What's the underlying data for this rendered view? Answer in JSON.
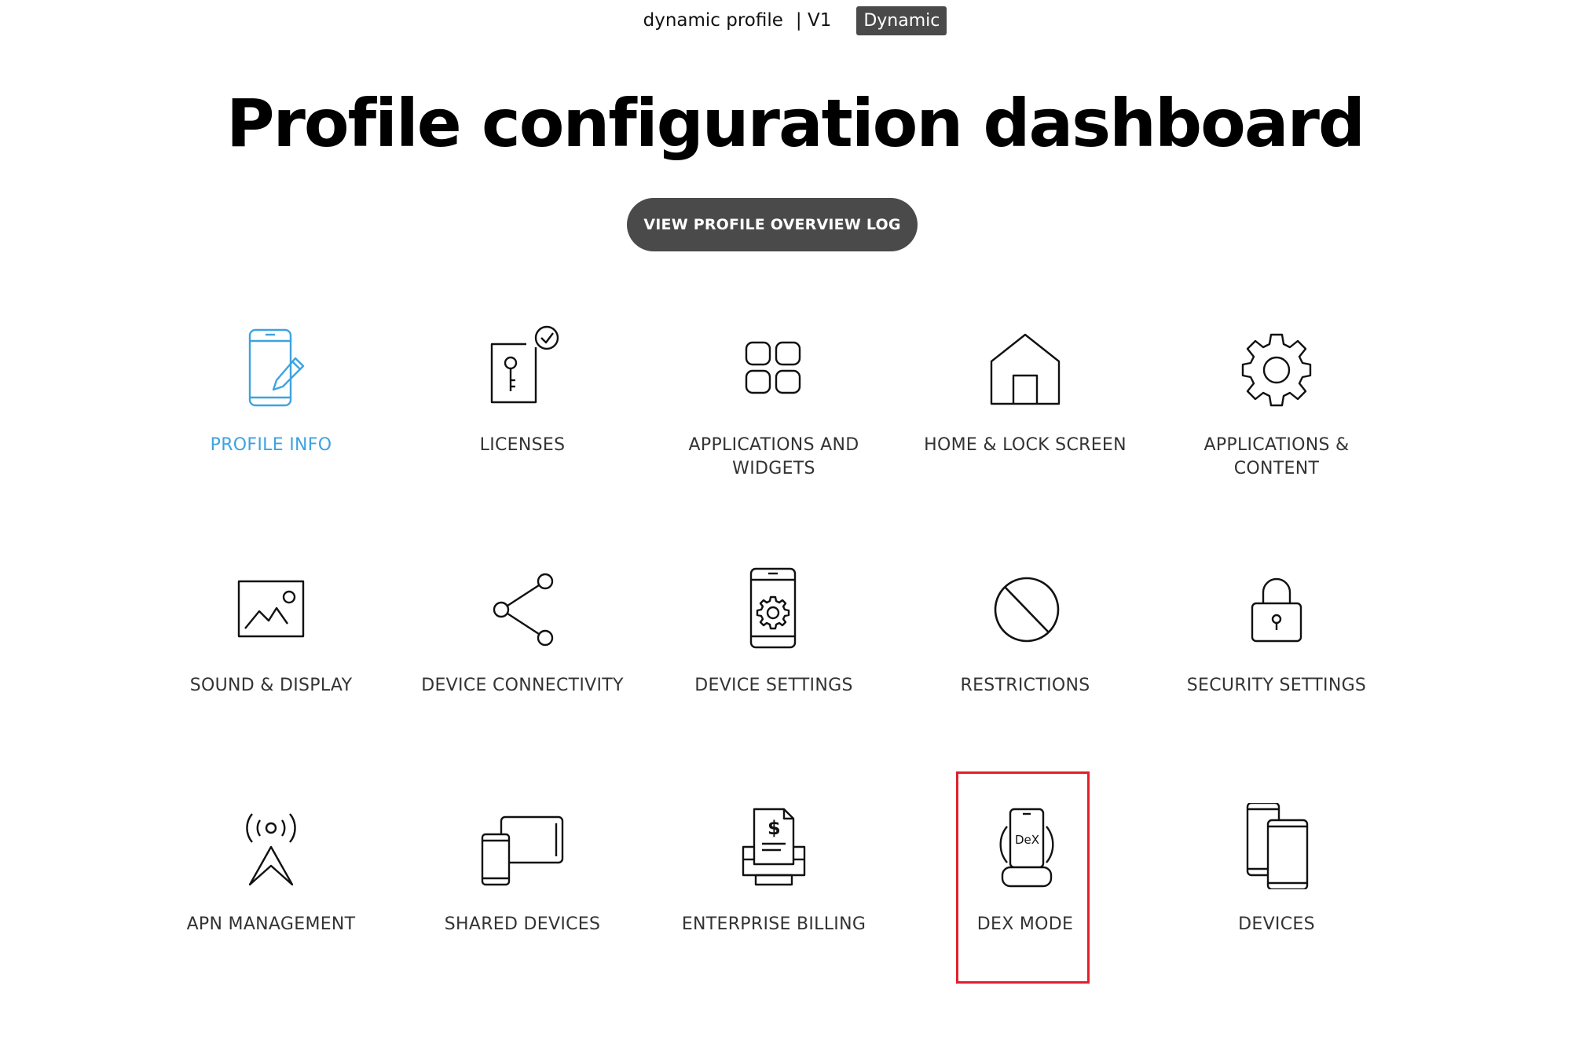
{
  "header": {
    "profile_name": "dynamic profile",
    "version": "| V1",
    "badge": "Dynamic"
  },
  "title": "Profile configuration dashboard",
  "overview_button": "VIEW PROFILE OVERVIEW LOG",
  "tiles": [
    {
      "label": "PROFILE INFO",
      "icon": "phone-edit-icon",
      "active": true
    },
    {
      "label": "LICENSES",
      "icon": "license-key-icon"
    },
    {
      "label": "APPLICATIONS AND WIDGETS",
      "icon": "apps-grid-icon"
    },
    {
      "label": "HOME & LOCK SCREEN",
      "icon": "home-icon"
    },
    {
      "label": "APPLICATIONS & CONTENT",
      "icon": "gear-icon"
    },
    {
      "label": "SOUND & DISPLAY",
      "icon": "image-icon"
    },
    {
      "label": "DEVICE CONNECTIVITY",
      "icon": "share-icon"
    },
    {
      "label": "DEVICE SETTINGS",
      "icon": "phone-settings-icon"
    },
    {
      "label": "RESTRICTIONS",
      "icon": "prohibited-icon"
    },
    {
      "label": "SECURITY SETTINGS",
      "icon": "lock-icon"
    },
    {
      "label": "APN MANAGEMENT",
      "icon": "antenna-icon"
    },
    {
      "label": "SHARED DEVICES",
      "icon": "shared-devices-icon"
    },
    {
      "label": "ENTERPRISE BILLING",
      "icon": "billing-icon"
    },
    {
      "label": "DEX MODE",
      "icon": "dex-icon",
      "dex_text": "DeX"
    },
    {
      "label": "DEVICES",
      "icon": "devices-icon"
    }
  ],
  "colors": {
    "active": "#3da3e0",
    "button_bg": "#4a4a4a",
    "highlight": "#e0202a"
  }
}
